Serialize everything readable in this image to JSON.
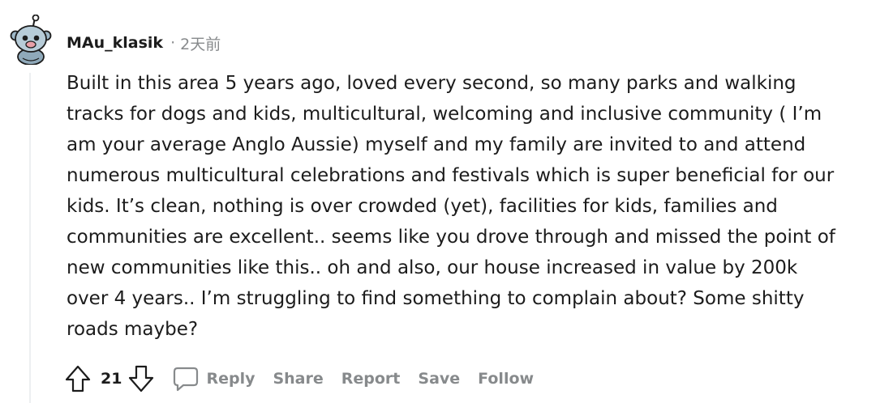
{
  "comment": {
    "username": "MAu_klasik",
    "separator": "·",
    "timestamp": "2天前",
    "body_lines": [
      "Built in this area 5 years ago, loved every second, so many parks and walking",
      "tracks for dogs and kids, multicultural, welcoming and inclusive community ( I’m",
      "am your average Anglo Aussie) myself and my family are invited to and attend",
      "numerous multicultural celebrations and festivals which is super beneficial for our",
      "kids. It’s clean, nothing is over crowded (yet), facilities for kids, families and",
      "communities are excellent.. seems like you drove through and missed the point of",
      "new communities like this.. oh and also, our house increased in value by 200k",
      "over 4 years.. I’m struggling to find something to complain about? Some shitty",
      "roads maybe?"
    ],
    "score": "21"
  },
  "actions": {
    "reply": "Reply",
    "share": "Share",
    "report": "Report",
    "save": "Save",
    "follow": "Follow"
  },
  "icons": {
    "avatar": "snoo-avatar-icon",
    "upvote": "arrow-up-icon",
    "downvote": "arrow-down-icon",
    "reply": "speech-bubble-icon"
  },
  "colors": {
    "text": "#1c1c1c",
    "muted": "#878a8c",
    "thread_line": "#edeff1",
    "avatar_bg": "#9fb9c9"
  }
}
